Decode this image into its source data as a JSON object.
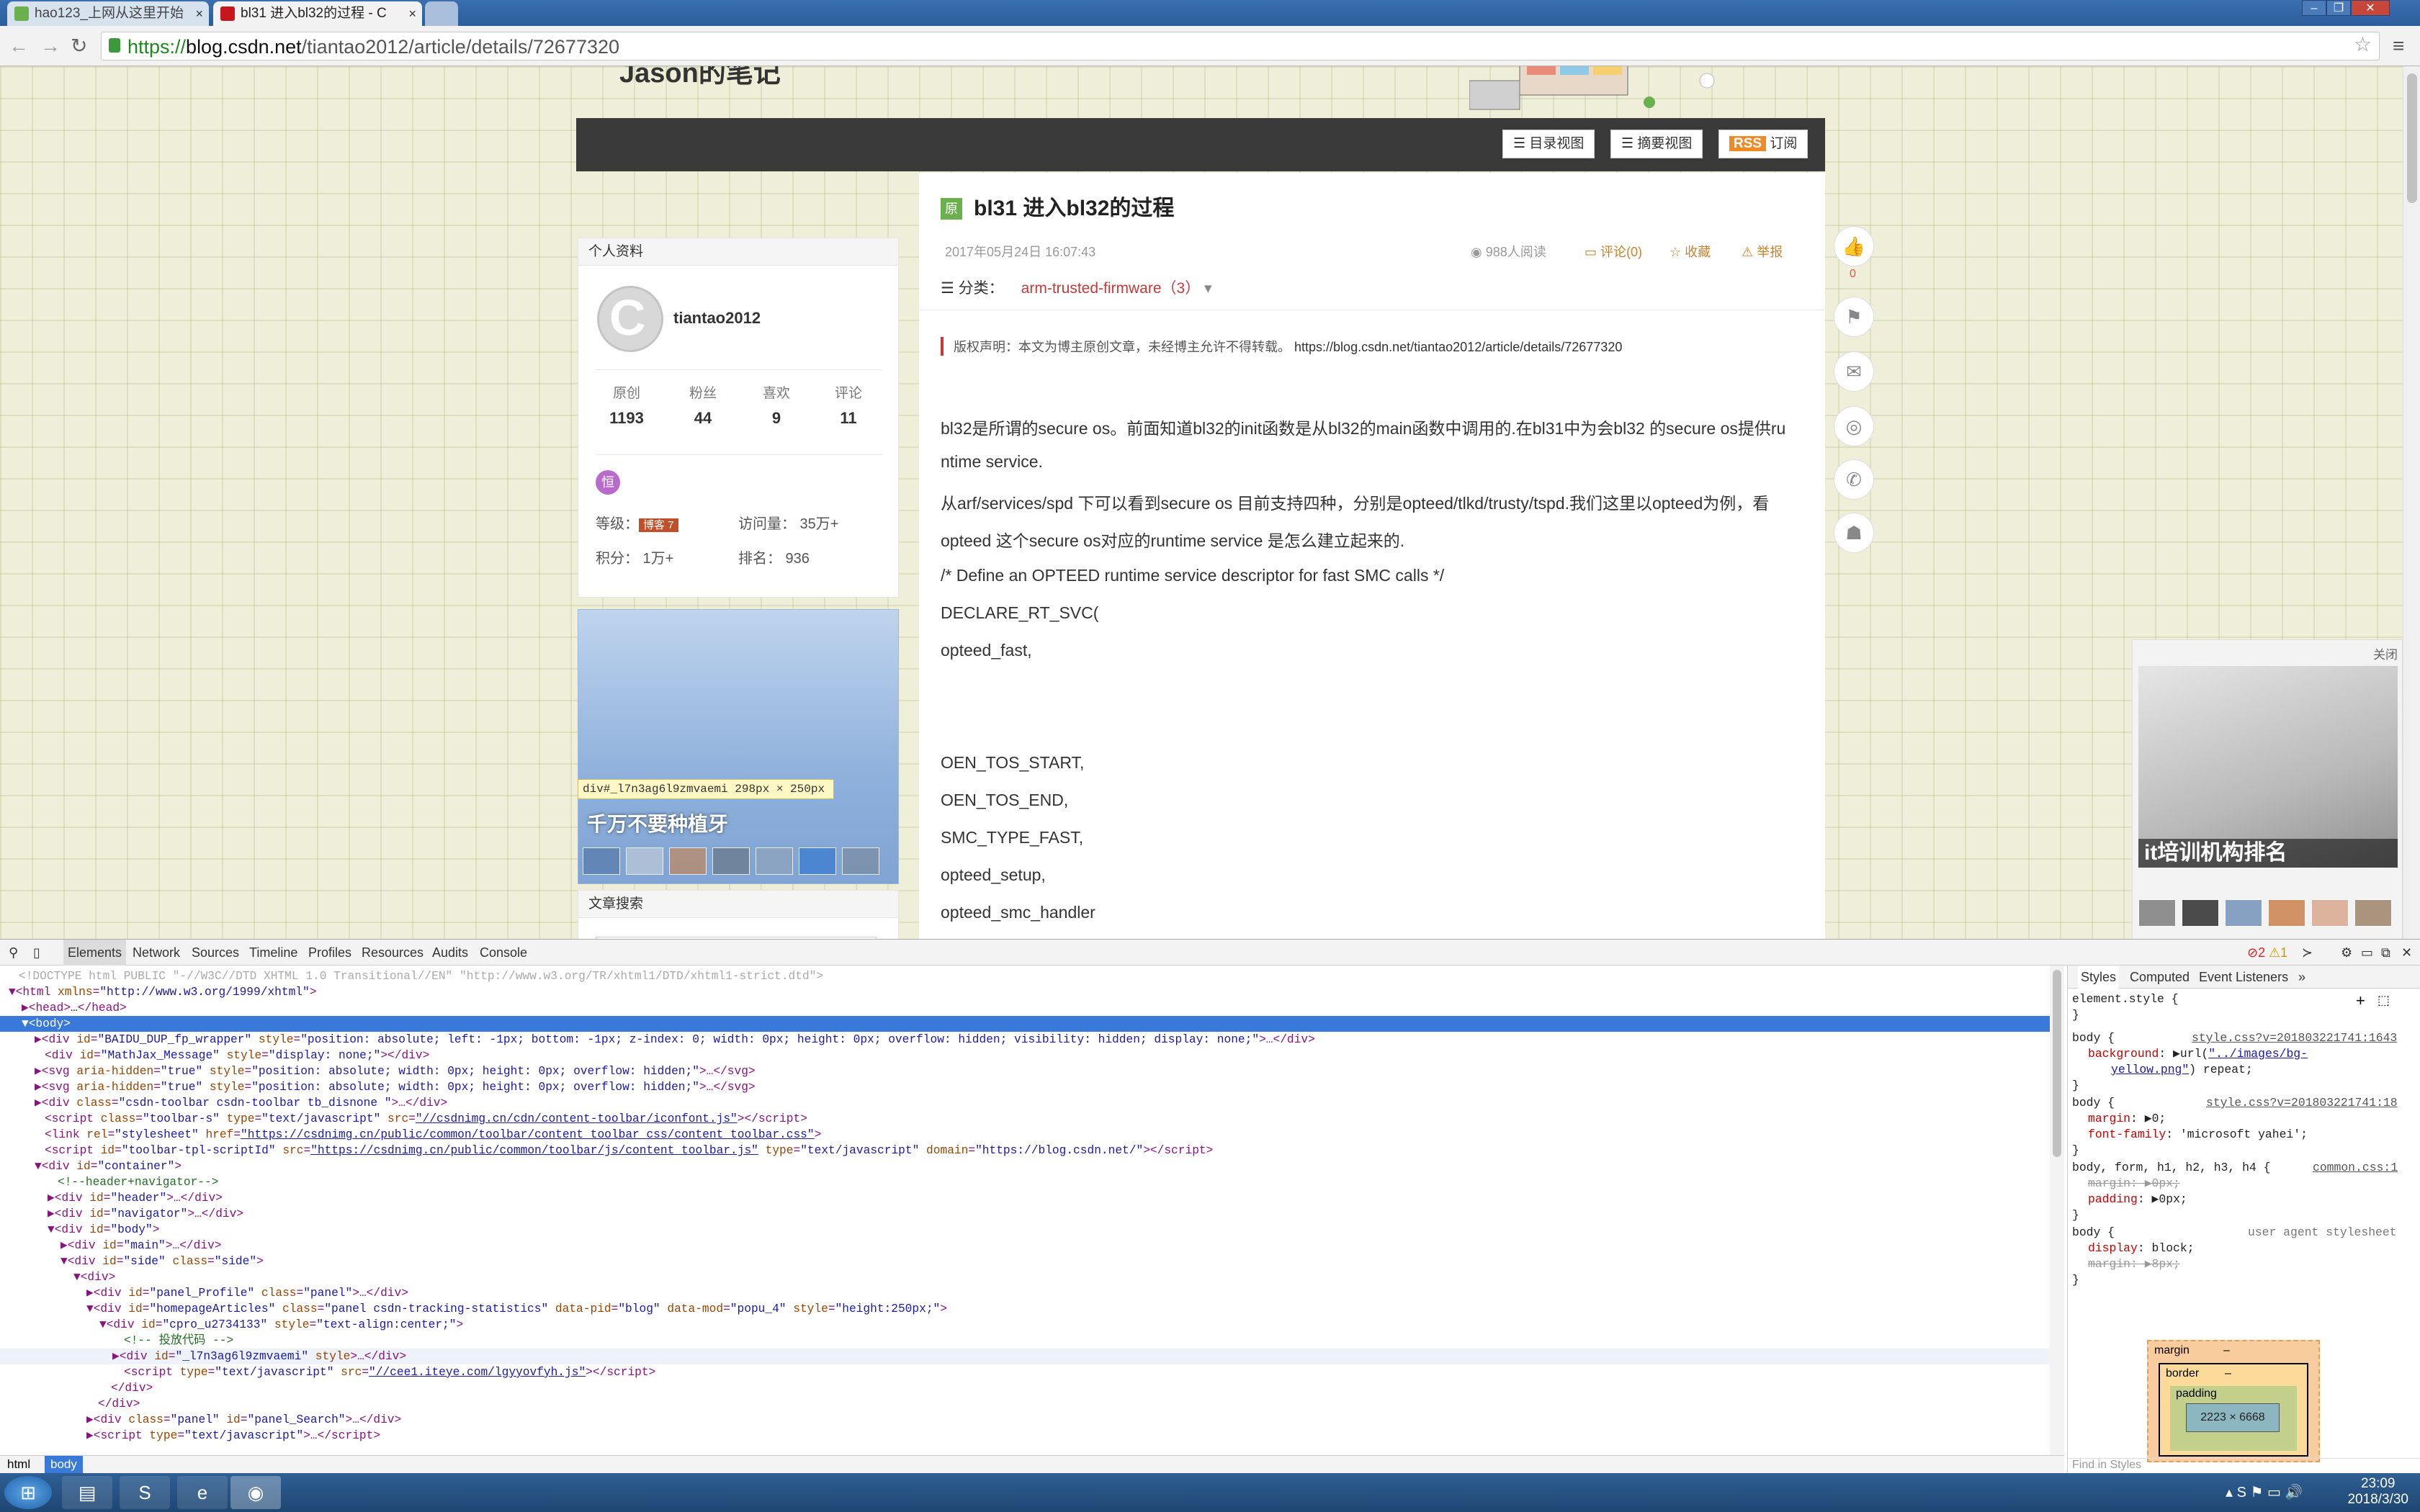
{
  "tabs": [
    {
      "title": "hao123_上网从这里开始",
      "close": "×"
    },
    {
      "title": "bl31 进入bl32的过程 - C",
      "close": "×"
    }
  ],
  "window": {
    "minimize": "–",
    "restore": "❐",
    "close": "✕"
  },
  "address": {
    "scheme": "https://",
    "domain": "blog.csdn.net",
    "path": "/tiantao2012/article/details/72677320"
  },
  "blog": {
    "header_title": "Jason的笔记"
  },
  "view_buttons": {
    "catalog": "目录视图",
    "summary": "摘要视图",
    "rss_badge": "RSS",
    "subscribe": "订阅"
  },
  "profile": {
    "panel_title": "个人资料",
    "username": "tiantao2012",
    "avatar_letter": "C",
    "stats": [
      {
        "label": "原创",
        "value": "1193"
      },
      {
        "label": "粉丝",
        "value": "44"
      },
      {
        "label": "喜欢",
        "value": "9"
      },
      {
        "label": "评论",
        "value": "11"
      }
    ],
    "badge": "恒",
    "level_label": "等级：",
    "level_badge": "博客 7",
    "visits": "访问量： 35万+",
    "points": "积分： 1万+",
    "rank": "排名： 936"
  },
  "ad_left": {
    "caption": "千万不要种植牙"
  },
  "inspect_tip": "div#_l7n3ag6l9zmvaemi 298px × 250px",
  "search_panel": {
    "title": "文章搜索"
  },
  "article": {
    "badge": "原",
    "title": "bl31 进入bl32的过程",
    "date": "2017年05月24日 16:07:43",
    "reads": "988人阅读",
    "comments": "评论(0)",
    "favorite": "收藏",
    "report": "举报",
    "category_label": "分类：",
    "category": "arm-trusted-firmware（3）",
    "copyright": "版权声明：本文为博主原创文章，未经博主允许不得转载。",
    "copyright_link": "https://blog.csdn.net/tiantao2012/article/details/72677320",
    "paragraphs": [
      "bl32是所谓的secure os。前面知道bl32的init函数是从bl32的main函数中调用的.在bl31中为会bl32 的secure os提供ru",
      "ntime service.",
      "从arf/services/spd 下可以看到secure os 目前支持四种，分别是opteed/tlkd/trusty/tspd.我们这里以opteed为例，看",
      "opteed 这个secure os对应的runtime service 是怎么建立起来的.",
      "/* Define an OPTEED runtime service descriptor for fast SMC calls */",
      "DECLARE_RT_SVC(",
      "opteed_fast,",
      "OEN_TOS_START,",
      "OEN_TOS_END,",
      "SMC_TYPE_FAST,",
      "opteed_setup,",
      "opteed_smc_handler"
    ]
  },
  "float_icons": {
    "like_count": "0"
  },
  "ad_right": {
    "close": "关闭",
    "caption": "it培训机构排名"
  },
  "devtools": {
    "tabs": [
      "Elements",
      "Network",
      "Sources",
      "Timeline",
      "Profiles",
      "Resources",
      "Audits",
      "Console"
    ],
    "errors": "2",
    "warnings": "1",
    "style_tabs": [
      "Styles",
      "Computed",
      "Event Listeners"
    ],
    "crumbs": [
      "html",
      "body"
    ],
    "find_placeholder": "Find in Styles",
    "box": {
      "margin": "margin",
      "border": "border",
      "padding": "padding",
      "content": "2223 × 6668",
      "dash": "–"
    }
  },
  "taskbar": {
    "time": "23:09",
    "date": "2018/3/30"
  }
}
